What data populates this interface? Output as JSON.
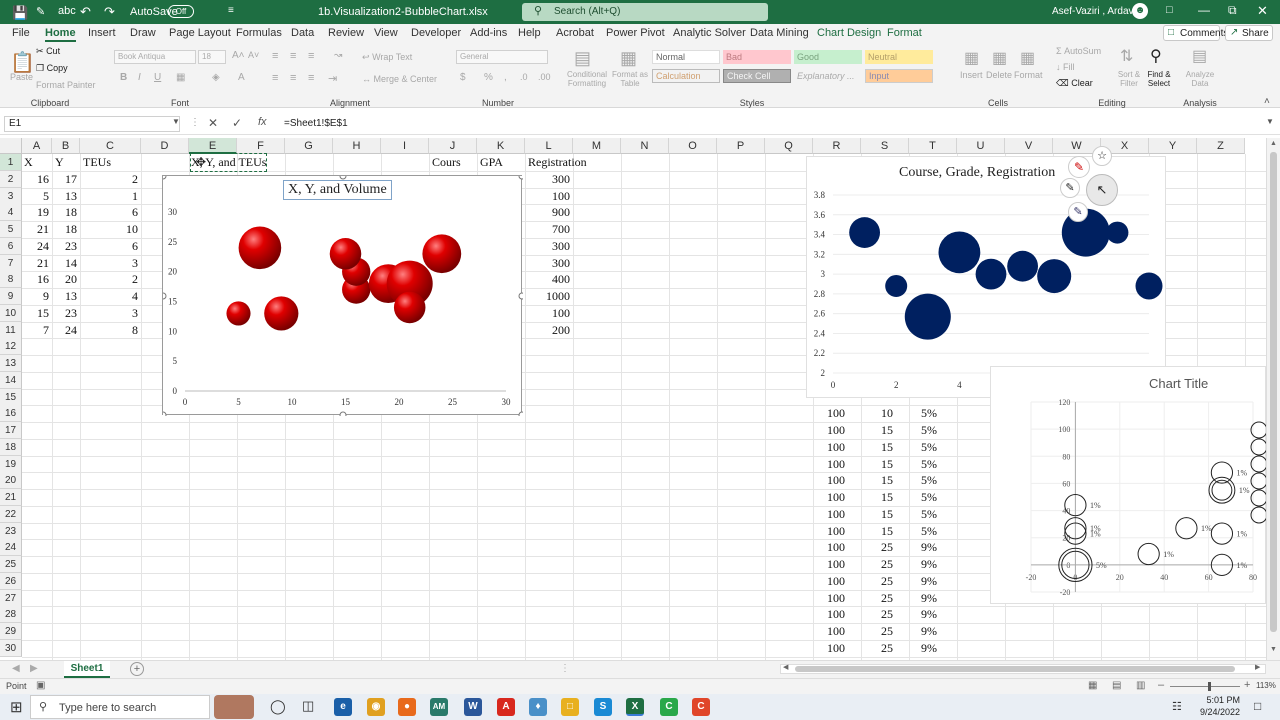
{
  "titlebar": {
    "autosave_label": "AutoSave",
    "autosave_state": "Off",
    "filename": "1b.Visualization2-BubbleChart.xlsx",
    "search_placeholder": "Search (Alt+Q)",
    "user": "Asef-Vaziri , Ardavan"
  },
  "tabs": [
    "File",
    "Home",
    "Insert",
    "Draw",
    "Page Layout",
    "Formulas",
    "Data",
    "Review",
    "View",
    "Developer",
    "Add-ins",
    "Help",
    "Acrobat",
    "Power Pivot",
    "Analytic Solver",
    "Data Mining",
    "Chart Design",
    "Format"
  ],
  "comments_label": "Comments",
  "share_label": "Share",
  "ribbon": {
    "paste": "Paste",
    "cut": "Cut",
    "copy": "Copy",
    "format_painter": "Format Painter",
    "font_name": "Book Antiqua",
    "font_size": "18",
    "wrap_text": "Wrap Text",
    "merge_center": "Merge & Center",
    "number_format": "General",
    "conditional": "Conditional Formatting",
    "format_table": "Format as Table",
    "styles": [
      "Normal",
      "Bad",
      "Good",
      "Neutral",
      "Calculation",
      "Check Cell",
      "Explanatory ...",
      "Input"
    ],
    "insert": "Insert",
    "delete": "Delete",
    "format": "Format",
    "autosum": "AutoSum",
    "fill": "Fill",
    "clear": "Clear",
    "sort_filter": "Sort & Filter",
    "find_select": "Find & Select",
    "analyze": "Analyze Data",
    "groups": [
      "Clipboard",
      "Font",
      "Alignment",
      "Number",
      "Styles",
      "Cells",
      "Editing",
      "Analysis"
    ]
  },
  "formula_bar": {
    "name_box": "E1",
    "formula": "=Sheet1!$E$1"
  },
  "columns": [
    "A",
    "B",
    "C",
    "D",
    "E",
    "F",
    "G",
    "H",
    "I",
    "J",
    "K",
    "L",
    "M",
    "N",
    "O",
    "P",
    "Q",
    "R",
    "S",
    "T",
    "U",
    "V",
    "W",
    "X",
    "Y",
    "Z"
  ],
  "rows": [
    "1",
    "2",
    "3",
    "4",
    "5",
    "6",
    "7",
    "8",
    "9",
    "10",
    "11",
    "12",
    "13",
    "14",
    "15",
    "16",
    "17",
    "18",
    "19",
    "20",
    "21",
    "22",
    "23",
    "24",
    "25",
    "26",
    "27",
    "28",
    "29",
    "30"
  ],
  "headers": {
    "a": "X",
    "b": "Y",
    "c": "TEUs",
    "e": "X, Y, and TEUs",
    "j": "Cours",
    "k": "GPA",
    "l": "Registration"
  },
  "data_rows": [
    {
      "x": "16",
      "y": "17",
      "teu": "2",
      "reg": "300"
    },
    {
      "x": "5",
      "y": "13",
      "teu": "1",
      "reg": "100"
    },
    {
      "x": "19",
      "y": "18",
      "teu": "6",
      "reg": "900"
    },
    {
      "x": "21",
      "y": "18",
      "teu": "10",
      "reg": "700"
    },
    {
      "x": "24",
      "y": "23",
      "teu": "6",
      "reg": "300"
    },
    {
      "x": "21",
      "y": "14",
      "teu": "3",
      "reg": "300"
    },
    {
      "x": "16",
      "y": "20",
      "teu": "2",
      "reg": "400"
    },
    {
      "x": "9",
      "y": "13",
      "teu": "4",
      "reg": "1000"
    },
    {
      "x": "15",
      "y": "23",
      "teu": "3",
      "reg": "100"
    },
    {
      "x": "7",
      "y": "24",
      "teu": "8",
      "reg": "200"
    }
  ],
  "right_rows": [
    {
      "r": "100",
      "s": "10",
      "t": "5%"
    },
    {
      "r": "100",
      "s": "15",
      "t": "5%"
    },
    {
      "r": "100",
      "s": "15",
      "t": "5%"
    },
    {
      "r": "100",
      "s": "15",
      "t": "5%"
    },
    {
      "r": "100",
      "s": "15",
      "t": "5%"
    },
    {
      "r": "100",
      "s": "15",
      "t": "5%"
    },
    {
      "r": "100",
      "s": "15",
      "t": "5%"
    },
    {
      "r": "100",
      "s": "15",
      "t": "5%"
    },
    {
      "r": "100",
      "s": "25",
      "t": "9%"
    },
    {
      "r": "100",
      "s": "25",
      "t": "9%"
    },
    {
      "r": "100",
      "s": "25",
      "t": "9%"
    },
    {
      "r": "100",
      "s": "25",
      "t": "9%"
    },
    {
      "r": "100",
      "s": "25",
      "t": "9%"
    },
    {
      "r": "100",
      "s": "25",
      "t": "9%"
    },
    {
      "r": "100",
      "s": "25",
      "t": "9%"
    }
  ],
  "chart_data": [
    {
      "type": "scatter",
      "title": "X, Y, and Volume",
      "xlim": [
        0,
        30
      ],
      "ylim": [
        0,
        30
      ],
      "xticks": [
        "0",
        "5",
        "10",
        "15",
        "20",
        "25",
        "30"
      ],
      "yticks": [
        "0",
        "5",
        "10",
        "15",
        "20",
        "25",
        "30"
      ],
      "bubble_color": "#c00000",
      "points": [
        {
          "x": 16,
          "y": 17,
          "size": 2
        },
        {
          "x": 5,
          "y": 13,
          "size": 1
        },
        {
          "x": 19,
          "y": 18,
          "size": 6
        },
        {
          "x": 21,
          "y": 18,
          "size": 10
        },
        {
          "x": 24,
          "y": 23,
          "size": 6
        },
        {
          "x": 21,
          "y": 14,
          "size": 3
        },
        {
          "x": 16,
          "y": 20,
          "size": 2
        },
        {
          "x": 9,
          "y": 13,
          "size": 4
        },
        {
          "x": 15,
          "y": 23,
          "size": 3
        },
        {
          "x": 7,
          "y": 24,
          "size": 8
        }
      ]
    },
    {
      "type": "scatter",
      "title": "Course, Grade, Registration",
      "xlim": [
        0,
        10
      ],
      "ylim": [
        2,
        3.8
      ],
      "xticks": [
        "0",
        "2",
        "4"
      ],
      "yticks": [
        "2",
        "2.2",
        "2.4",
        "2.6",
        "2.8",
        "3",
        "3.2",
        "3.4",
        "3.6",
        "3.8"
      ],
      "bubble_color": "#002060",
      "points": [
        {
          "x": 1,
          "y": 3.42,
          "size": 300
        },
        {
          "x": 2,
          "y": 2.88,
          "size": 100
        },
        {
          "x": 3,
          "y": 2.57,
          "size": 900
        },
        {
          "x": 4,
          "y": 3.22,
          "size": 700
        },
        {
          "x": 5,
          "y": 3.0,
          "size": 300
        },
        {
          "x": 6,
          "y": 3.08,
          "size": 300
        },
        {
          "x": 7,
          "y": 2.98,
          "size": 400
        },
        {
          "x": 8,
          "y": 3.42,
          "size": 1000
        },
        {
          "x": 9,
          "y": 3.42,
          "size": 100
        },
        {
          "x": 10,
          "y": 2.88,
          "size": 200
        }
      ]
    },
    {
      "type": "scatter",
      "title": "Chart Title",
      "xlim": [
        -20,
        80
      ],
      "ylim": [
        -20,
        120
      ],
      "xticks": [
        "-20",
        "0",
        "20",
        "40",
        "60",
        "80"
      ],
      "yticks": [
        "-20",
        "0",
        "20",
        "40",
        "60",
        "80",
        "100",
        "120"
      ],
      "bubble_color": "#333333",
      "points": [
        {
          "x": 0,
          "y": 0,
          "size": 60,
          "label": "5%"
        },
        {
          "x": 0,
          "y": 44,
          "size": 14,
          "label": "1%"
        },
        {
          "x": 0,
          "y": 27,
          "size": 14,
          "label": "1%"
        },
        {
          "x": 0,
          "y": 23,
          "size": 14,
          "label": "1%"
        },
        {
          "x": 33,
          "y": 8,
          "size": 14,
          "label": "1%"
        },
        {
          "x": 50,
          "y": 27,
          "size": 14,
          "label": "1%"
        },
        {
          "x": 66,
          "y": 68,
          "size": 14,
          "label": "1%"
        },
        {
          "x": 66,
          "y": 55,
          "size": 28,
          "label": "1%"
        },
        {
          "x": 66,
          "y": 23,
          "size": 14,
          "label": "1%"
        },
        {
          "x": 66,
          "y": 0,
          "size": 14,
          "label": "1%"
        }
      ]
    }
  ],
  "sheet_tab": "Sheet1",
  "status": {
    "mode": "Point",
    "zoom": "113%"
  },
  "taskbar": {
    "search_placeholder": "Type here to search",
    "time": "5:01 PM",
    "date": "9/24/2022"
  }
}
